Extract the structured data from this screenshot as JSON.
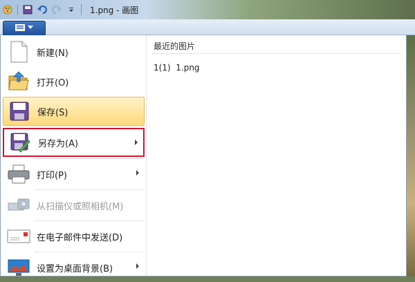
{
  "window": {
    "title": "1.png - 画图"
  },
  "app_menu": {
    "button_icon": "paint-app-menu-icon"
  },
  "menu_items": [
    {
      "label": "新建(N)",
      "icon": "new-document-icon",
      "has_submenu": false,
      "enabled": true
    },
    {
      "label": "打开(O)",
      "icon": "open-folder-icon",
      "has_submenu": false,
      "enabled": true
    },
    {
      "label": "保存(S)",
      "icon": "save-disk-icon",
      "has_submenu": false,
      "enabled": true
    },
    {
      "label": "另存为(A)",
      "icon": "save-as-icon",
      "has_submenu": true,
      "enabled": true
    },
    {
      "label": "打印(P)",
      "icon": "printer-icon",
      "has_submenu": true,
      "enabled": true
    },
    {
      "label": "从扫描仪或照相机(M)",
      "icon": "scanner-camera-icon",
      "has_submenu": false,
      "enabled": false
    },
    {
      "label": "在电子邮件中发送(D)",
      "icon": "email-icon",
      "has_submenu": false,
      "enabled": true
    },
    {
      "label": "设置为桌面背景(B)",
      "icon": "desktop-background-icon",
      "has_submenu": true,
      "enabled": true
    }
  ],
  "recent": {
    "title": "最近的图片",
    "items": [
      {
        "label": "1(1)  1.png"
      }
    ]
  },
  "colors": {
    "hover": "#ffd97a",
    "highlight_box": "#d0142c",
    "accent": "#1f4f9a"
  }
}
